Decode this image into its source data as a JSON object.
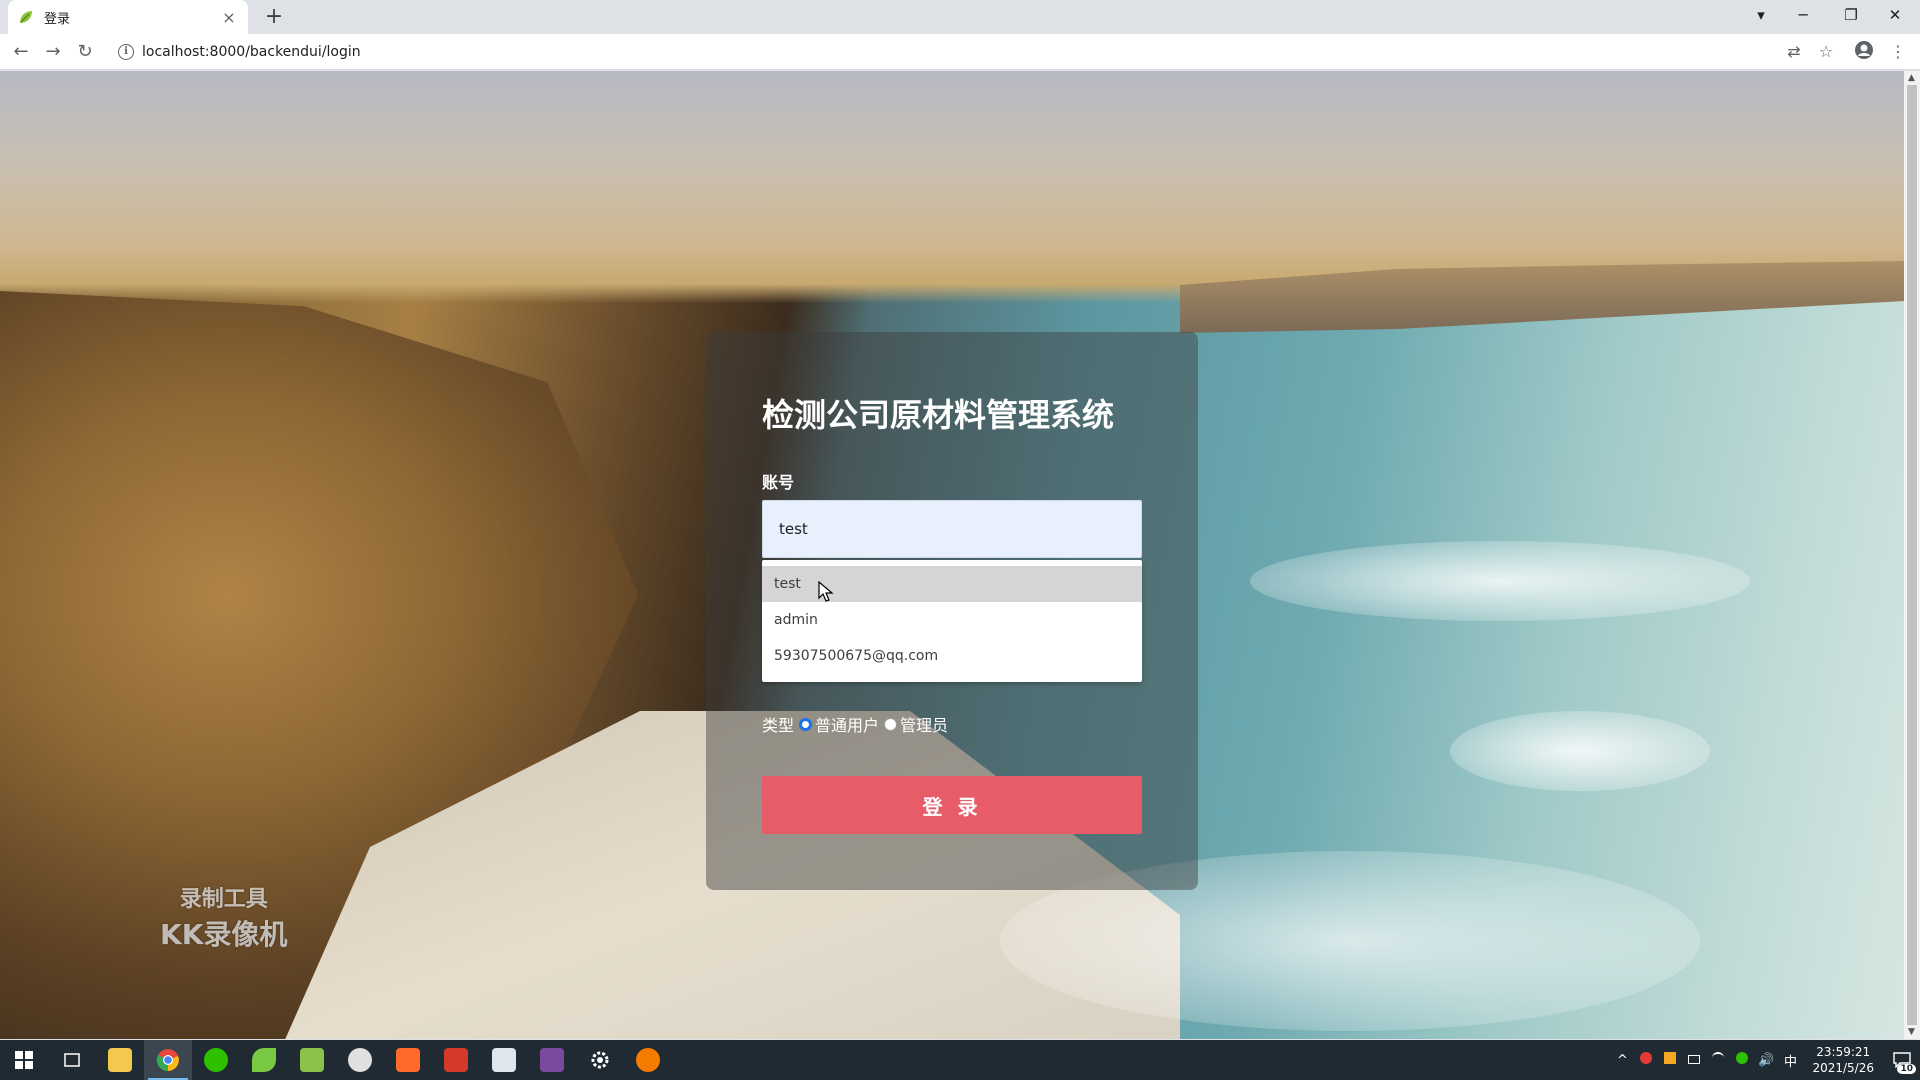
{
  "browser": {
    "tab_title": "登录",
    "close_glyph": "×",
    "new_tab_glyph": "+",
    "url": "localhost:8000/backendui/login",
    "back_glyph": "←",
    "forward_glyph": "→",
    "reload_glyph": "↻",
    "info_glyph": "i",
    "translate_glyph": "⇄",
    "star_glyph": "☆",
    "menu_glyph": "⋮",
    "minimize_glyph": "─",
    "restore_glyph": "❐",
    "window_close_glyph": "✕",
    "dropdown_glyph": "▾"
  },
  "login": {
    "system_title": "检测公司原材料管理系统",
    "account_label": "账号",
    "account_value": "test",
    "suggestions": [
      "test",
      "admin",
      "59307500675@qq.com"
    ],
    "type_label": "类型",
    "type_options": [
      "普通用户",
      "管理员"
    ],
    "selected_type": "普通用户",
    "submit_label": "登 录",
    "submit_color": "#e85c6a"
  },
  "watermark": {
    "line1": "录制工具",
    "line2": "KK录像机"
  },
  "taskbar": {
    "apps": [
      {
        "name": "start",
        "color": "#ffffff"
      },
      {
        "name": "task-view",
        "color": "#ffffff"
      },
      {
        "name": "file-explorer",
        "color": "#f2c94c"
      },
      {
        "name": "chrome",
        "color": "#e8453c",
        "active": true
      },
      {
        "name": "wechat",
        "color": "#2dc100"
      },
      {
        "name": "leaf-app",
        "color": "#7ac943"
      },
      {
        "name": "notepad",
        "color": "#8bc34a"
      },
      {
        "name": "helmet-app",
        "color": "#e0e0e0"
      },
      {
        "name": "orange-app",
        "color": "#ff6a2a"
      },
      {
        "name": "wps",
        "color": "#d33a2c"
      },
      {
        "name": "doc-app",
        "color": "#dfe6ee"
      },
      {
        "name": "game-app",
        "color": "#7b4a9e"
      },
      {
        "name": "settings",
        "color": "#ffffff"
      },
      {
        "name": "media-app",
        "color": "#f57c00"
      }
    ],
    "time": "23:59:21",
    "date": "2021/5/26",
    "ime": "中",
    "notification_count": "10",
    "tray_up_glyph": "^",
    "volume_glyph": "🔊"
  },
  "scrollbar": {
    "up_glyph": "▲",
    "down_glyph": "▼"
  }
}
